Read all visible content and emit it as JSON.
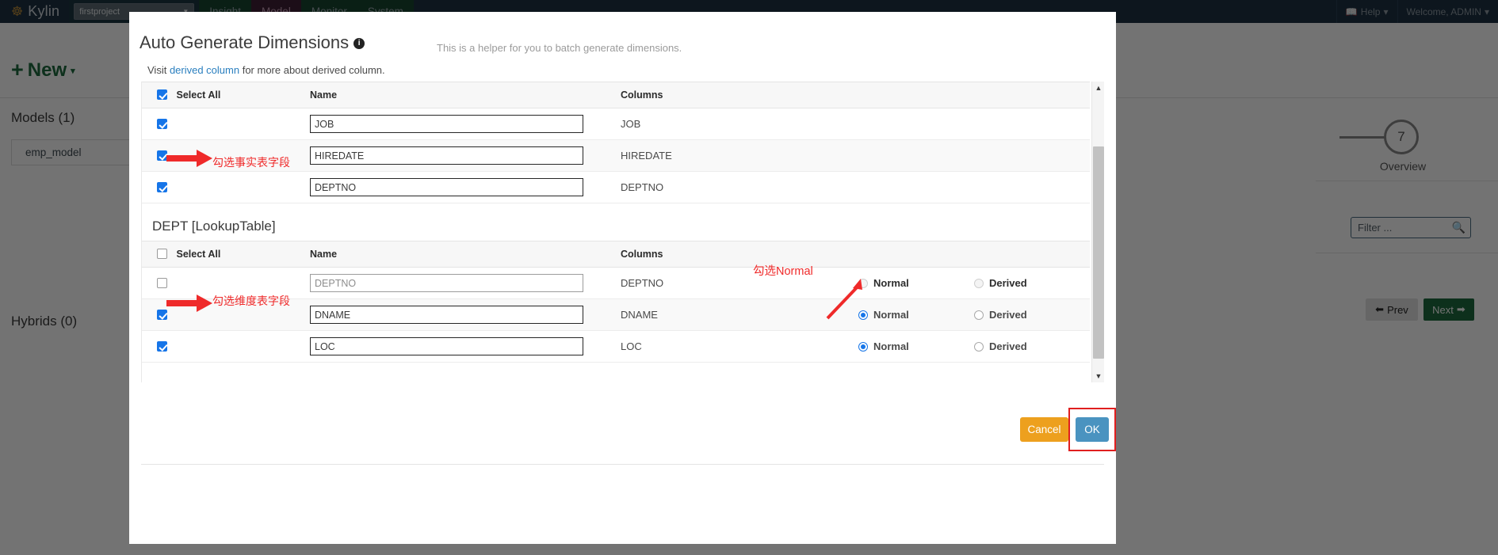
{
  "navbar": {
    "brand": "Kylin",
    "brand_logo_icon": "kylin-logo-icon",
    "project_value": "firstproject",
    "project_caret_icon": "caret-down-icon",
    "items": [
      {
        "label": "Insight",
        "active": false
      },
      {
        "label": "Model",
        "active": true
      },
      {
        "label": "Monitor",
        "active": false
      },
      {
        "label": "System",
        "active": false
      }
    ],
    "help_label": "Help",
    "help_icon": "book-icon",
    "help_caret_icon": "caret-down-icon",
    "user_label": "Welcome, ADMIN",
    "user_caret_icon": "caret-down-icon"
  },
  "background": {
    "new_button_label": "New",
    "new_plus_icon": "plus-icon",
    "new_caret_icon": "caret-down-icon",
    "models_title": "Models (1)",
    "model_card_name": "emp_model",
    "hybrids_title": "Hybrids (0)",
    "step_number": "7",
    "step_label": "Overview",
    "filter_placeholder": "Filter ...",
    "filter_icon": "search-icon",
    "prev_label": "Prev",
    "prev_icon": "arrow-left-icon",
    "next_label": "Next",
    "next_icon": "arrow-right-icon"
  },
  "modal": {
    "title": "Auto Generate Dimensions",
    "info_icon": "info-icon",
    "subtitle": "This is a helper for you to batch generate dimensions.",
    "note_prefix": "Visit ",
    "note_link": "derived column",
    "note_suffix": " for more about derived column.",
    "cancel_label": "Cancel",
    "ok_label": "OK",
    "scrollbar_up_icon": "chevron-up-icon",
    "scrollbar_down_icon": "chevron-down-icon",
    "columns": {
      "select_all": "Select All",
      "name": "Name",
      "columns": "Columns"
    },
    "fact_table": {
      "rows": [
        {
          "checked": true,
          "name": "JOB",
          "column": "JOB"
        },
        {
          "checked": true,
          "name": "HIREDATE",
          "column": "HIREDATE"
        },
        {
          "checked": true,
          "name": "DEPTNO",
          "column": "DEPTNO"
        }
      ],
      "select_all_checked": true
    },
    "lookup_table": {
      "title": "DEPT [LookupTable]",
      "select_all_checked": false,
      "normal_label": "Normal",
      "derived_label": "Derived",
      "rows": [
        {
          "checked": false,
          "name": "DEPTNO",
          "column": "DEPTNO",
          "mode": "none",
          "disabled": true
        },
        {
          "checked": true,
          "name": "DNAME",
          "column": "DNAME",
          "mode": "normal",
          "disabled": false
        },
        {
          "checked": true,
          "name": "LOC",
          "column": "LOC",
          "mode": "normal",
          "disabled": false
        }
      ]
    }
  },
  "annotations": [
    {
      "text": "勾选事实表字段",
      "color": "#ef2a2a"
    },
    {
      "text": "勾选维度表字段",
      "color": "#ef2a2a"
    },
    {
      "text": "勾选Normal",
      "color": "#ef2a2a"
    }
  ],
  "colors": {
    "navbar_bg": "#1d3244",
    "nav_green": "#17452f",
    "nav_active": "#3e1f35",
    "checkbox_blue": "#1675e8",
    "cancel_orange": "#eda01e",
    "ok_blue": "#4a93c0",
    "highlight_red": "#e01f1f",
    "next_green": "#1d6b3f"
  }
}
